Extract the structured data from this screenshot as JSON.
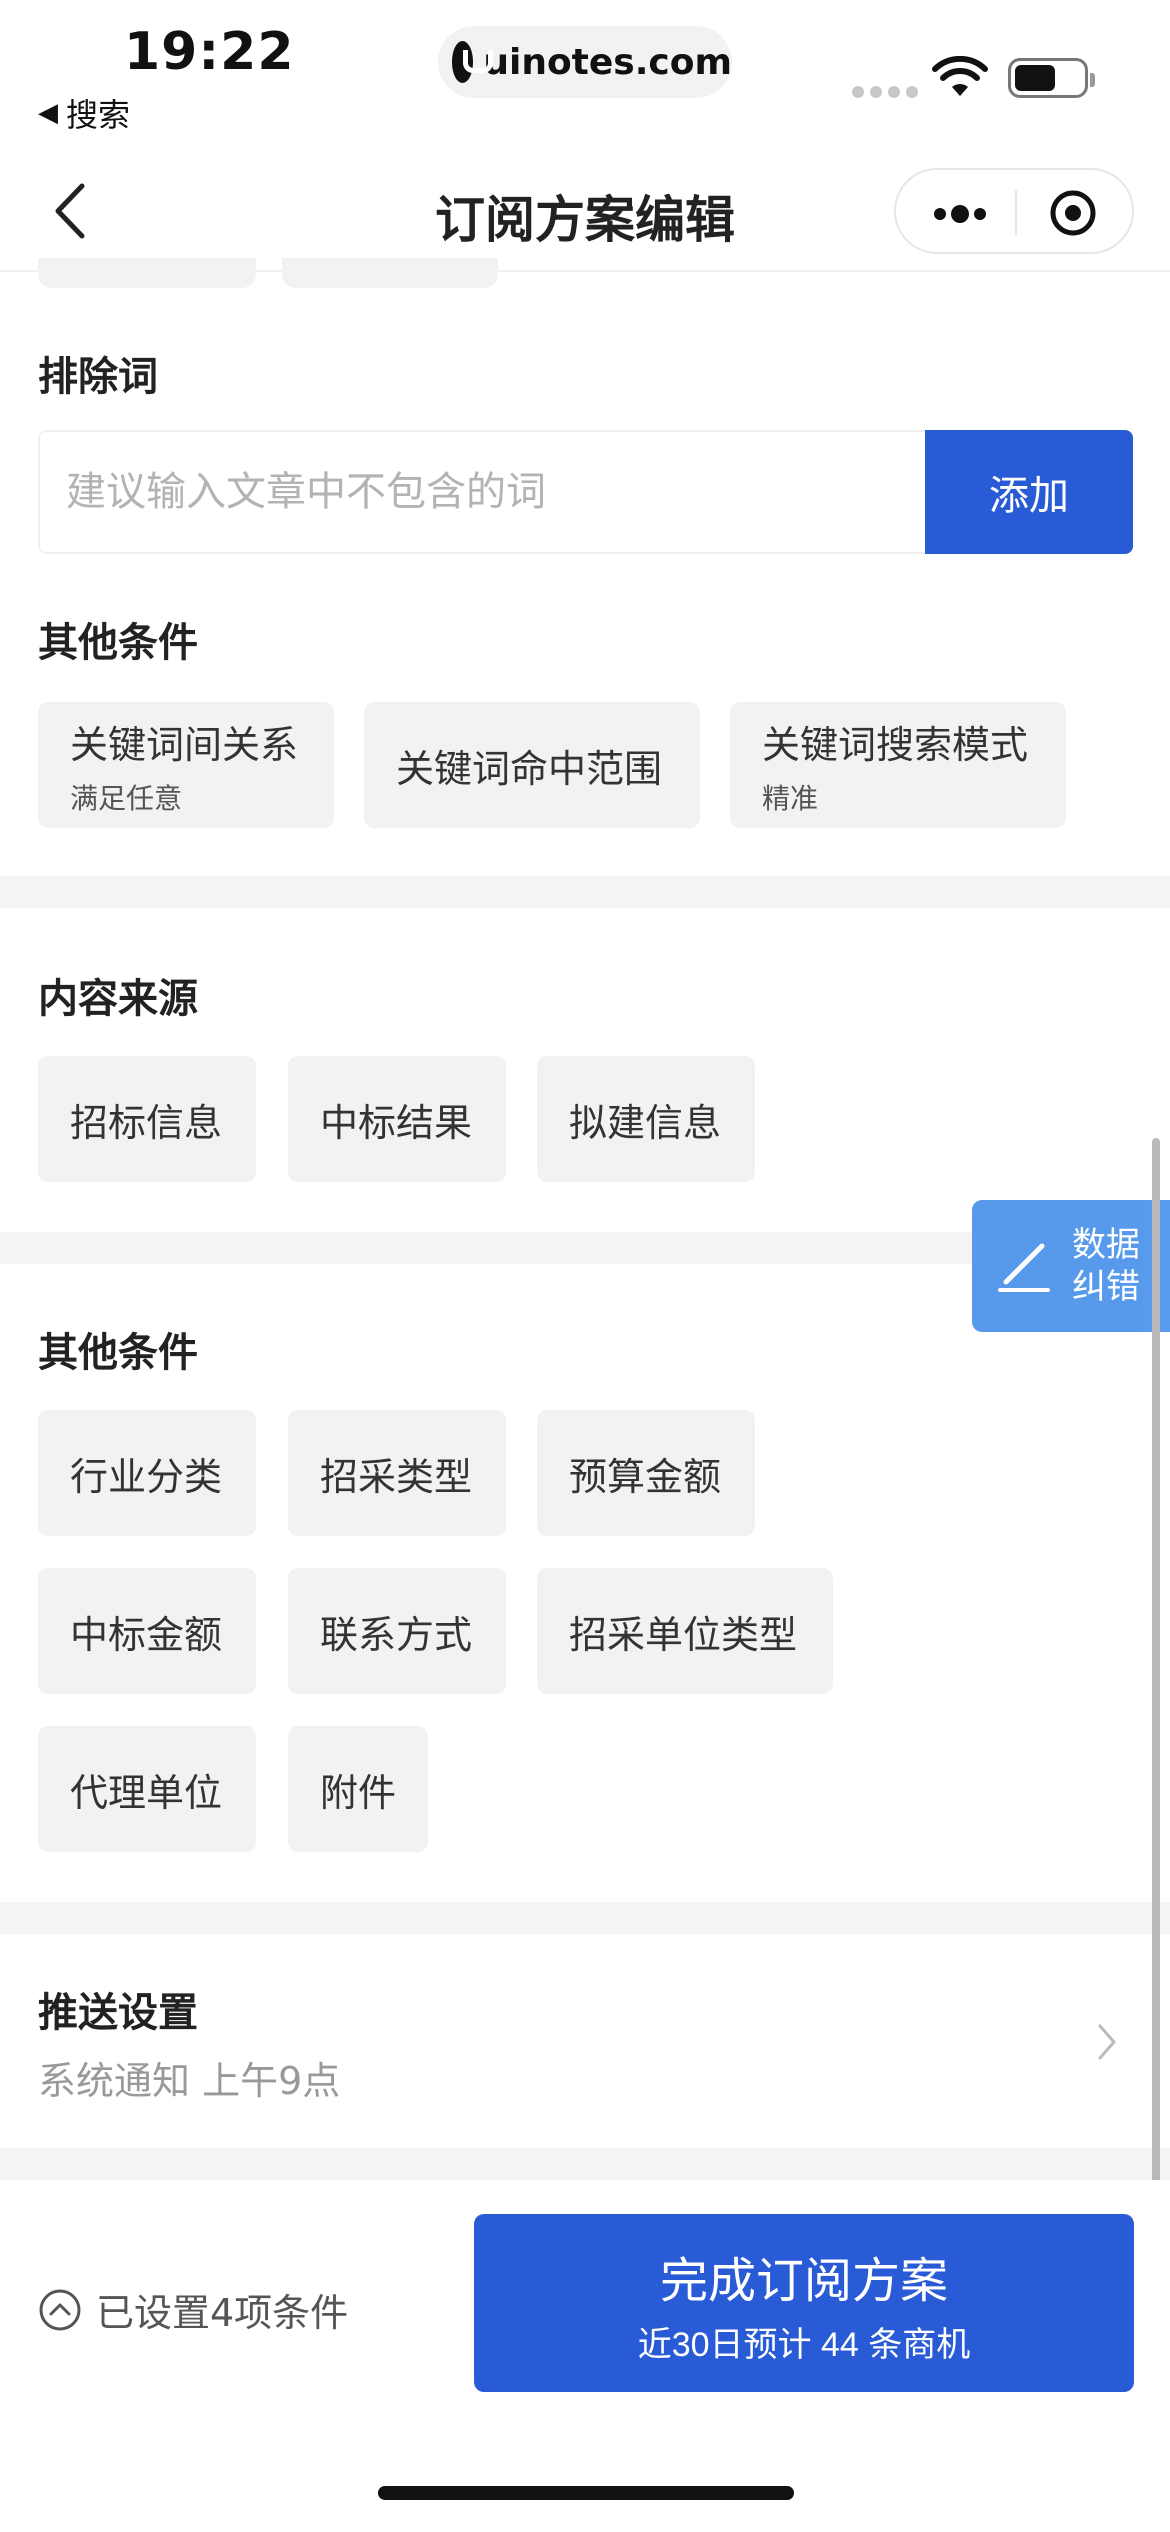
{
  "status_bar": {
    "time": "19:22",
    "back_app": "搜索",
    "url": "uinotes.com"
  },
  "nav": {
    "title": "订阅方案编辑"
  },
  "exclude_words": {
    "title": "排除词",
    "placeholder": "建议输入文章中不包含的词",
    "value": "",
    "add_label": "添加"
  },
  "other_conditions_1": {
    "title": "其他条件",
    "chips": [
      {
        "label": "关键词间关系",
        "sub": "满足任意"
      },
      {
        "label": "关键词命中范围",
        "sub": ""
      },
      {
        "label": "关键词搜索模式",
        "sub": "精准"
      }
    ]
  },
  "content_source": {
    "title": "内容来源",
    "chips": [
      "招标信息",
      "中标结果",
      "拟建信息"
    ]
  },
  "other_conditions_2": {
    "title": "其他条件",
    "chips": [
      "行业分类",
      "招采类型",
      "预算金额",
      "中标金额",
      "联系方式",
      "招采单位类型",
      "代理单位",
      "附件"
    ]
  },
  "push_settings": {
    "title": "推送设置",
    "summary": "系统通知 上午9点"
  },
  "float_button": {
    "line1": "数据",
    "line2": "纠错"
  },
  "bottom": {
    "conditions_set": "已设置4项条件",
    "finish_label": "完成订阅方案",
    "finish_sub": "近30日预计 44 条商机"
  },
  "colors": {
    "primary": "#2a5bd7",
    "float": "#4f95ea",
    "chip_bg": "#f2f2f2",
    "divider": "#f4f4f4"
  },
  "icons": [
    "back-chevron-icon",
    "more-dots-icon",
    "close-target-icon",
    "chevron-right-icon",
    "pen-icon",
    "chevron-up-circle-icon",
    "wifi-icon",
    "battery-icon"
  ]
}
